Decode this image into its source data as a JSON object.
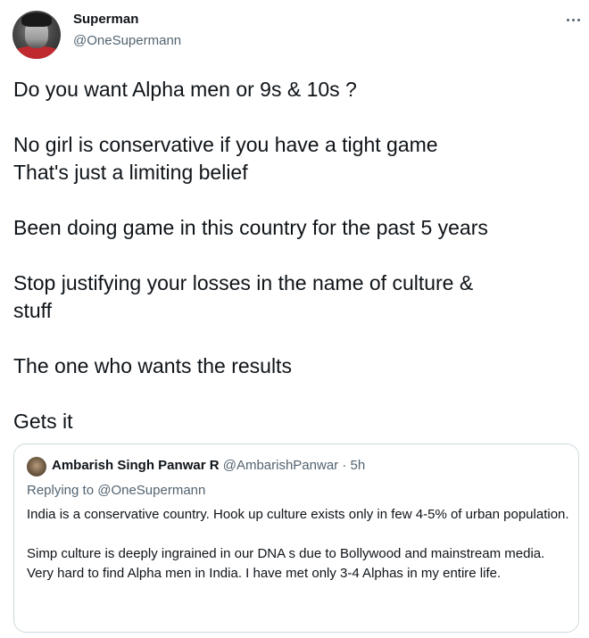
{
  "author": {
    "name": "Superman",
    "handle": "@OneSupermann"
  },
  "more_icon": "more-horizontal-icon",
  "tweet_paragraphs": [
    "Do you want Alpha men or 9s & 10s ?",
    "No girl is conservative if you have a tight game\nThat's just a limiting belief",
    "Been doing game in this country for the past 5 years",
    "Stop justifying your losses in the name of culture &\nstuff",
    "The one who wants the results",
    "Gets it"
  ],
  "quote": {
    "name": "Ambarish Singh Panwar R",
    "handle": "@AmbarishPanwar",
    "separator": "·",
    "time": "5h",
    "replying_label": "Replying to",
    "replying_to": "@OneSupermann",
    "paragraphs": [
      "India is a conservative country. Hook up culture exists only in few 4-5% of urban population.",
      "Simp culture is deeply ingrained in our DNA s due to Bollywood and mainstream media.\nVery hard to find Alpha men in India. I have met  only 3-4 Alphas in my entire life."
    ]
  },
  "colors": {
    "text_primary": "#0f1419",
    "text_secondary": "#536471",
    "border": "#cfd9de"
  }
}
